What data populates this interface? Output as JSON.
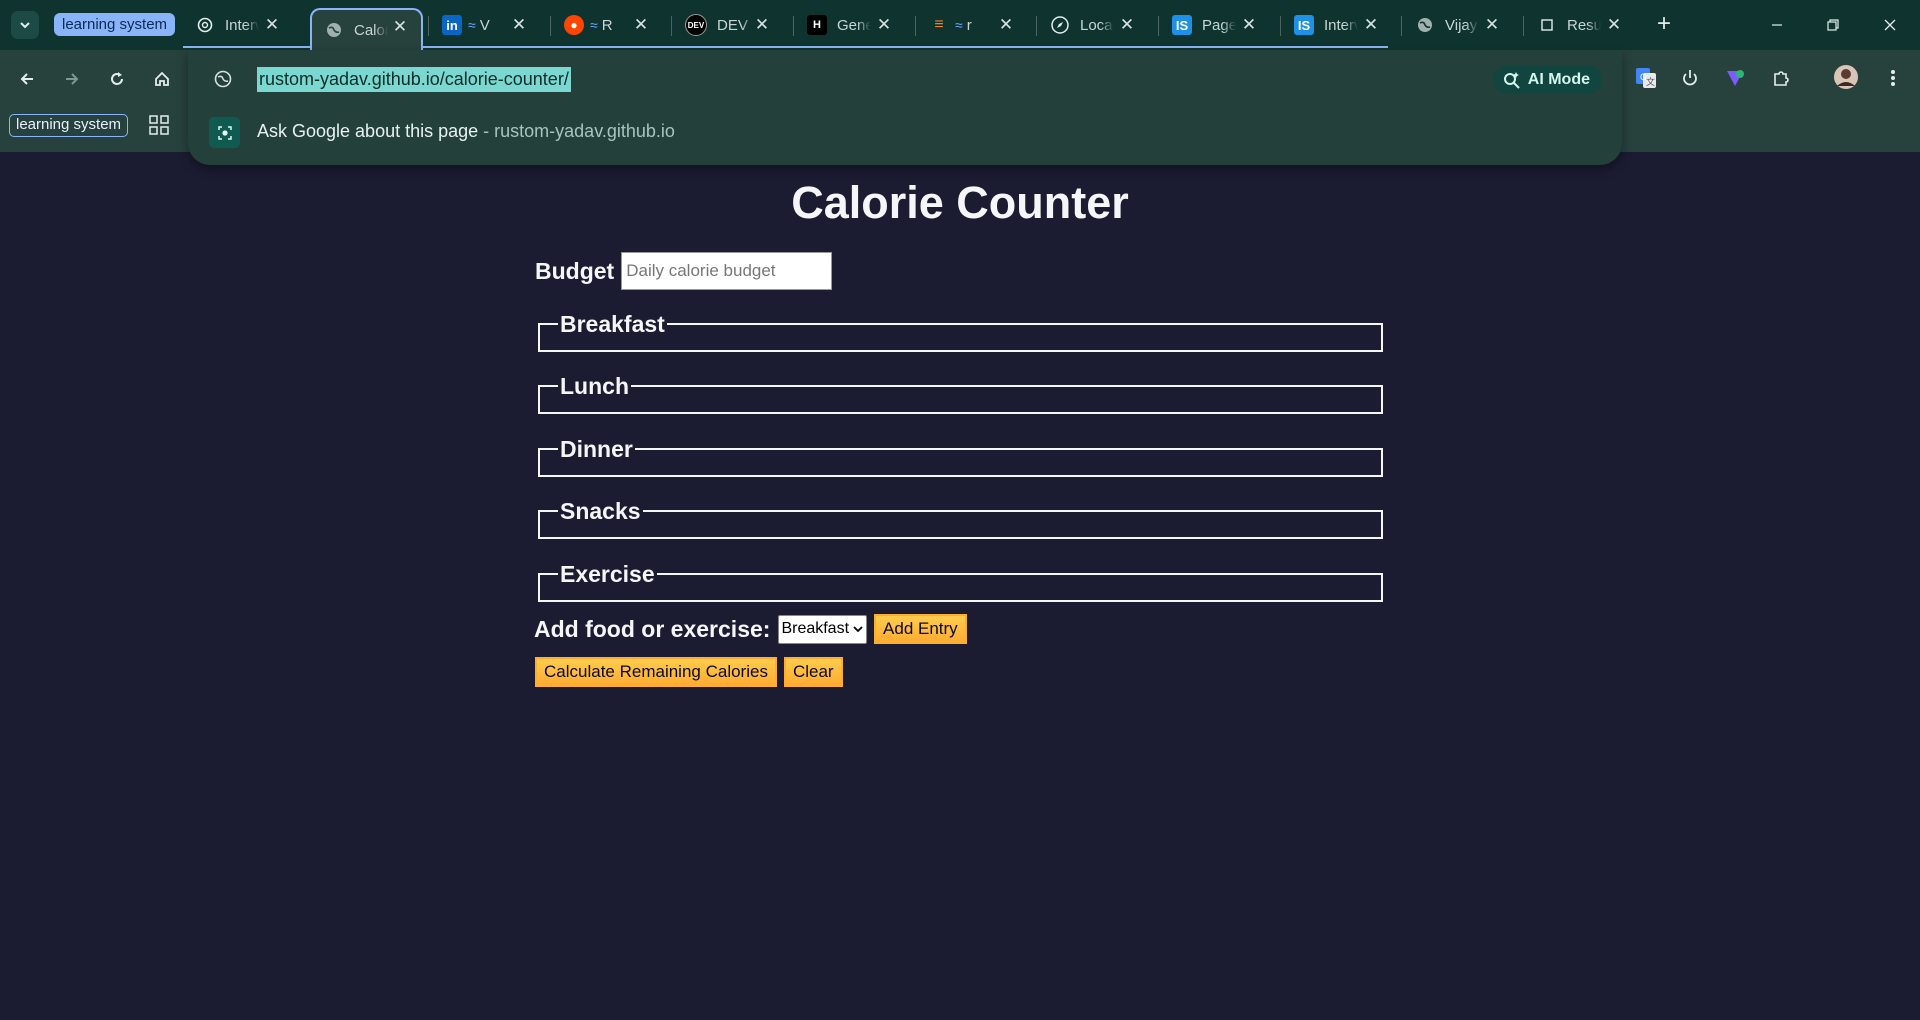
{
  "browser": {
    "group_label": "learning system",
    "tabs": [
      {
        "title": "Interview",
        "icon": "openai-icon"
      },
      {
        "title": "Calorie Counter",
        "icon": "globe-icon",
        "active": true
      },
      {
        "title": "V",
        "icon": "linkedin-icon"
      },
      {
        "title": "R",
        "icon": "reddit-icon"
      },
      {
        "title": "DEV",
        "icon": "dev-icon"
      },
      {
        "title": "General",
        "icon": "hashnode-icon"
      },
      {
        "title": "r",
        "icon": "stackoverflow-icon"
      },
      {
        "title": "Local",
        "icon": "compass-icon"
      },
      {
        "title": "Page",
        "icon": "is-icon"
      },
      {
        "title": "Interview",
        "icon": "is-icon"
      },
      {
        "title": "Vijay",
        "icon": "globe-icon"
      },
      {
        "title": "Resume",
        "icon": "doc-icon"
      }
    ],
    "bookmark_chip": "learning system",
    "accent": "#8ab4f8"
  },
  "omnibox": {
    "url": "rustom-yadav.github.io/calorie-counter/",
    "ai_mode_label": "AI Mode",
    "suggestion_text": "Ask Google about this page",
    "suggestion_separator": " - ",
    "suggestion_domain": "rustom-yadav.github.io"
  },
  "page": {
    "title": "Calorie Counter",
    "budget_label": "Budget",
    "budget_placeholder": "Daily calorie budget",
    "sections": [
      "Breakfast",
      "Lunch",
      "Dinner",
      "Snacks",
      "Exercise"
    ],
    "add_label": "Add food or exercise:",
    "select_value": "Breakfast",
    "add_entry_label": "Add Entry",
    "calculate_label": "Calculate Remaining Calories",
    "clear_label": "Clear",
    "button_color": "#feac32",
    "background": "#1b1b32"
  }
}
